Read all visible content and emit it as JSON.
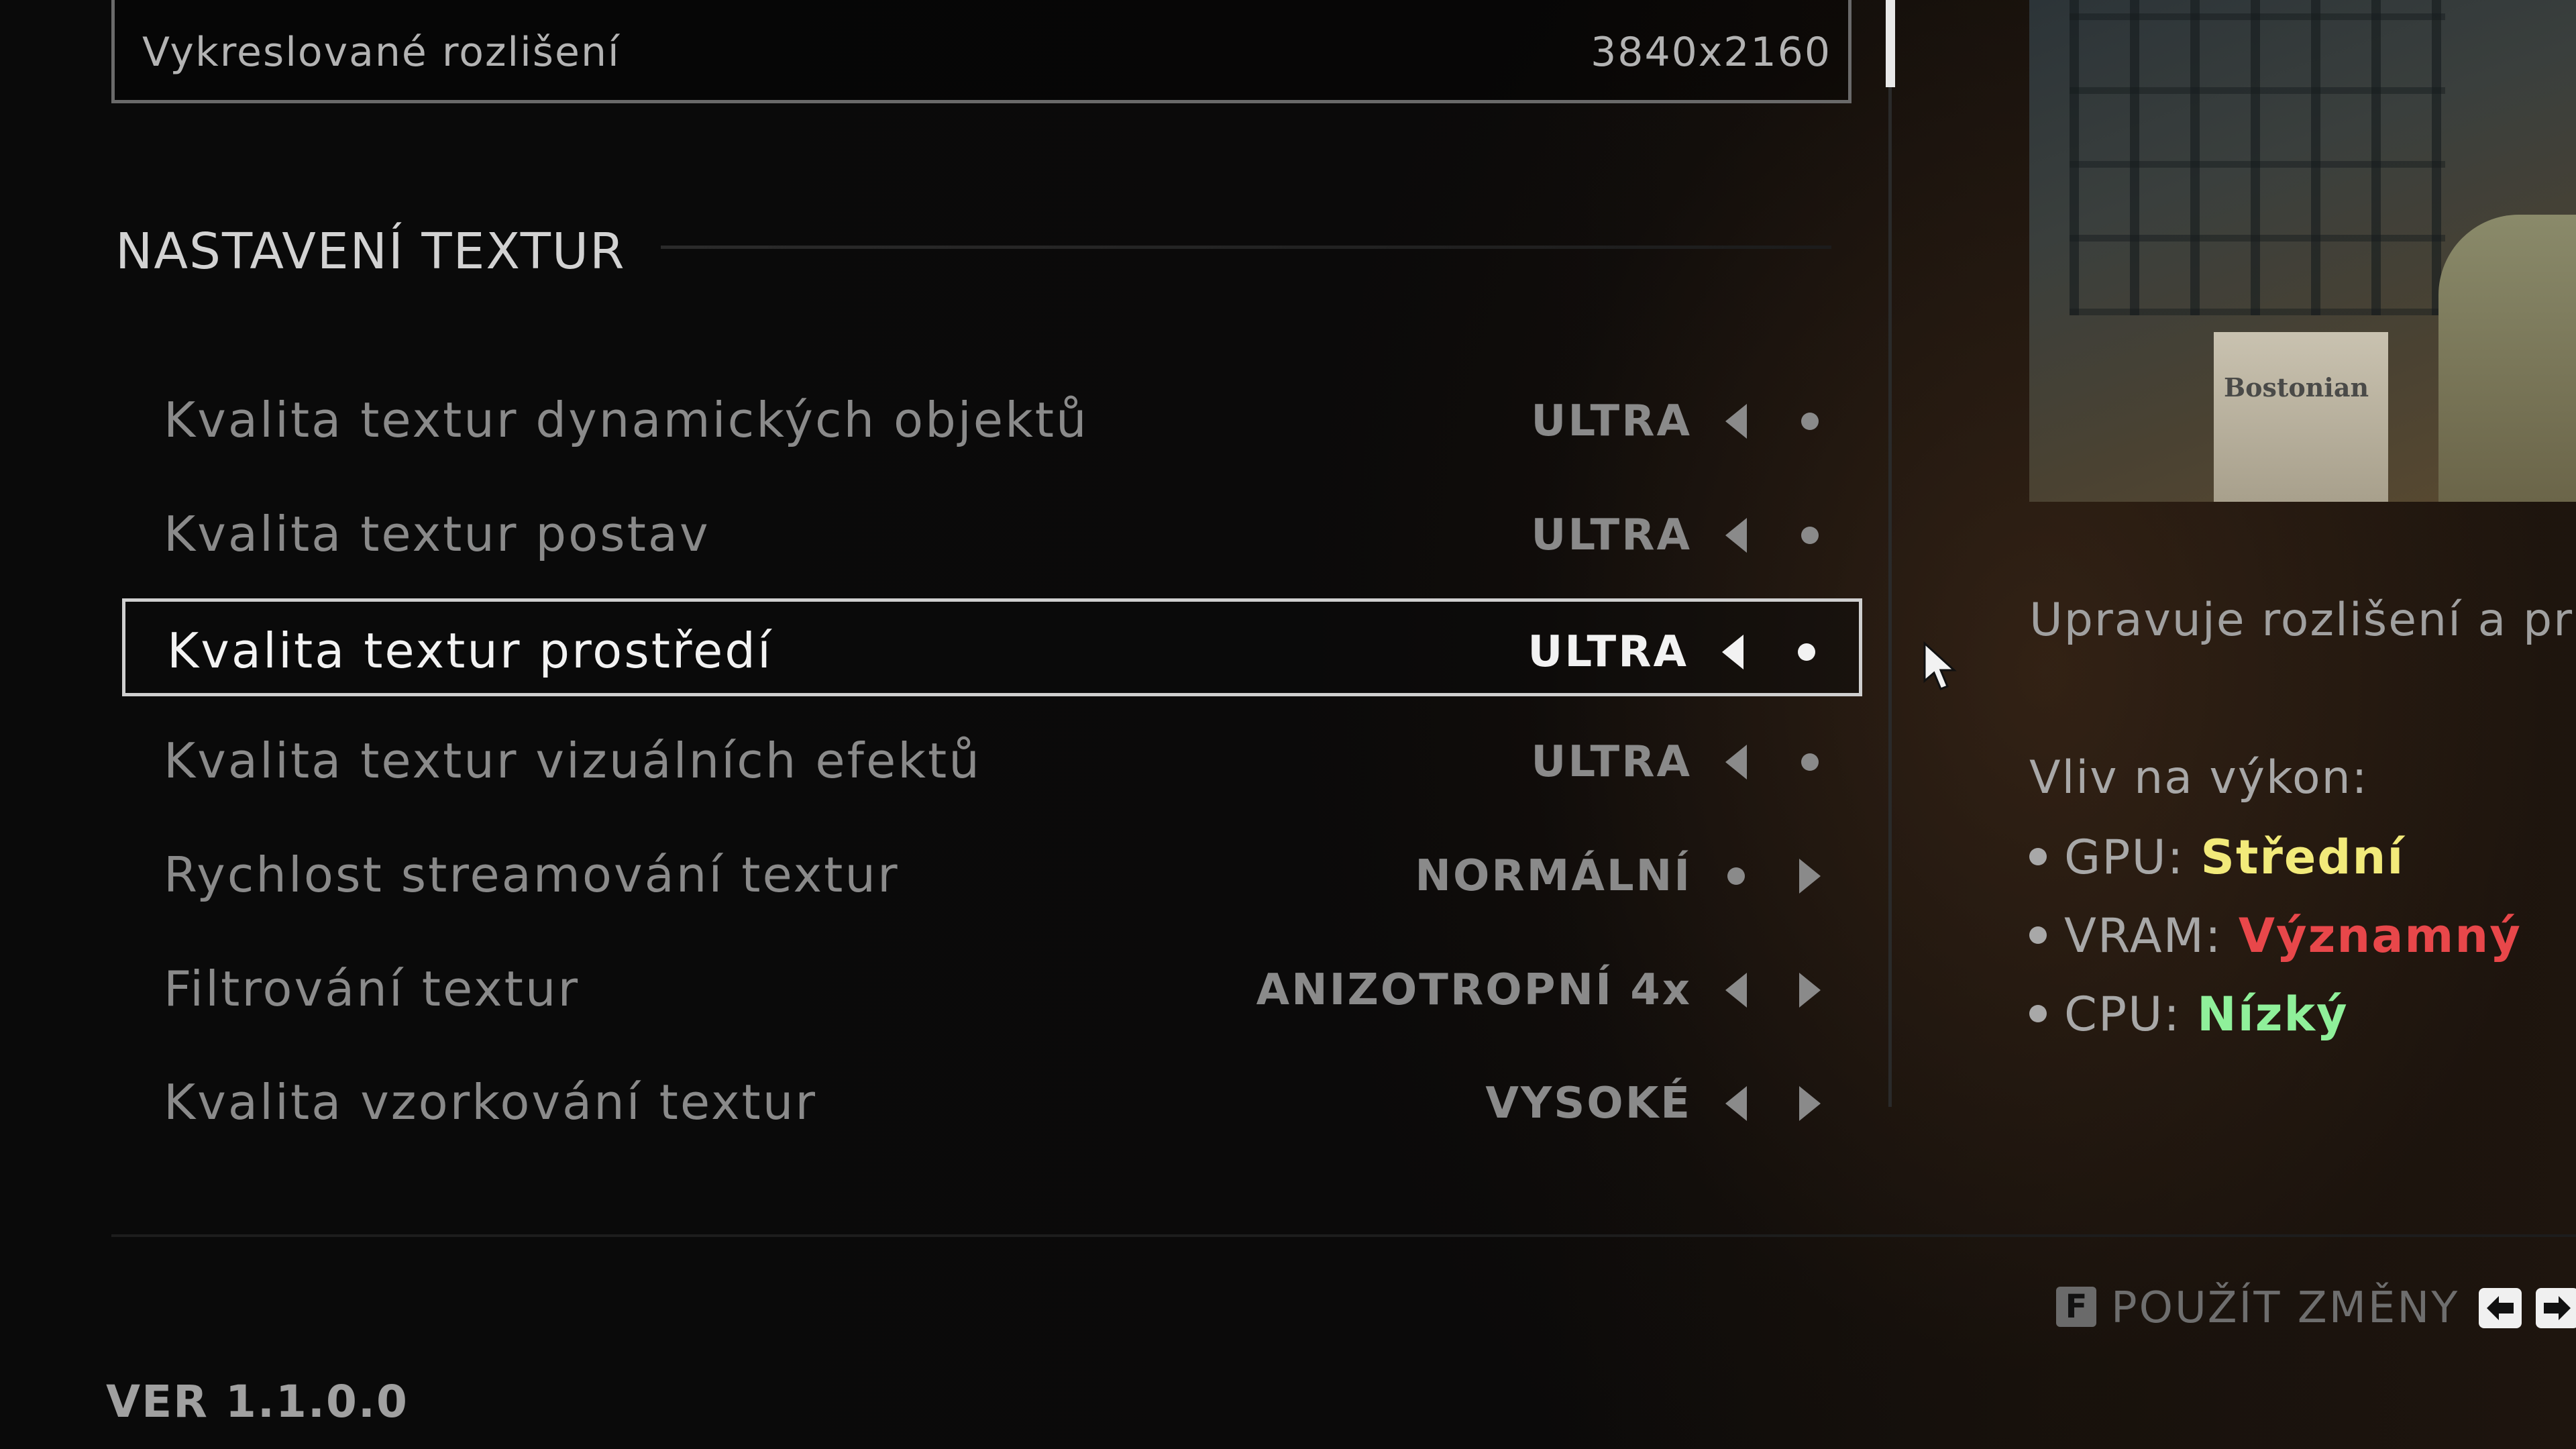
{
  "resolution_row": {
    "label": "Vykreslované rozlišení",
    "value": "3840x2160"
  },
  "section": {
    "title": "NASTAVENÍ TEXTUR"
  },
  "settings": [
    {
      "label": "Kvalita textur dynamických objektů",
      "value": "ULTRA",
      "left_control": "left-arrow",
      "right_control": "dot",
      "selected": false
    },
    {
      "label": "Kvalita textur postav",
      "value": "ULTRA",
      "left_control": "left-arrow",
      "right_control": "dot",
      "selected": false
    },
    {
      "label": "Kvalita textur prostředí",
      "value": "ULTRA",
      "left_control": "left-arrow",
      "right_control": "dot",
      "selected": true
    },
    {
      "label": "Kvalita textur vizuálních efektů",
      "value": "ULTRA",
      "left_control": "left-arrow",
      "right_control": "dot",
      "selected": false
    },
    {
      "label": "Rychlost streamování textur",
      "value": "NORMÁLNÍ",
      "left_control": "dot",
      "right_control": "right-arrow",
      "selected": false
    },
    {
      "label": "Filtrování textur",
      "value": "ANIZOTROPNÍ 4x",
      "left_control": "left-arrow",
      "right_control": "right-arrow",
      "selected": false
    },
    {
      "label": "Kvalita vzorkování textur",
      "value": "VYSOKÉ",
      "left_control": "left-arrow",
      "right_control": "right-arrow",
      "selected": false
    }
  ],
  "preview": {
    "sign_text": "Bostonian"
  },
  "info_panel": {
    "description": "Upravuje rozlišení a pri",
    "impact_title": "Vliv na výkon:",
    "impacts": [
      {
        "label": "GPU: ",
        "value": "Střední",
        "color": "#f2ea7a"
      },
      {
        "label": "VRAM: ",
        "value": "Významný",
        "color": "#e8474a"
      },
      {
        "label": "CPU: ",
        "value": "Nízký",
        "color": "#8ff09a"
      }
    ]
  },
  "footer": {
    "apply_key": "F",
    "apply_label": "POUŽÍT ZMĚNY",
    "nav_icons": [
      "arrow-left-key-icon",
      "arrow-right-key-icon"
    ],
    "version": "VER 1.1.0.0"
  },
  "colors": {
    "selected_text": "#f2f2f2",
    "inactive_text": "#8a8a8a",
    "background": "#0b0b0b"
  }
}
